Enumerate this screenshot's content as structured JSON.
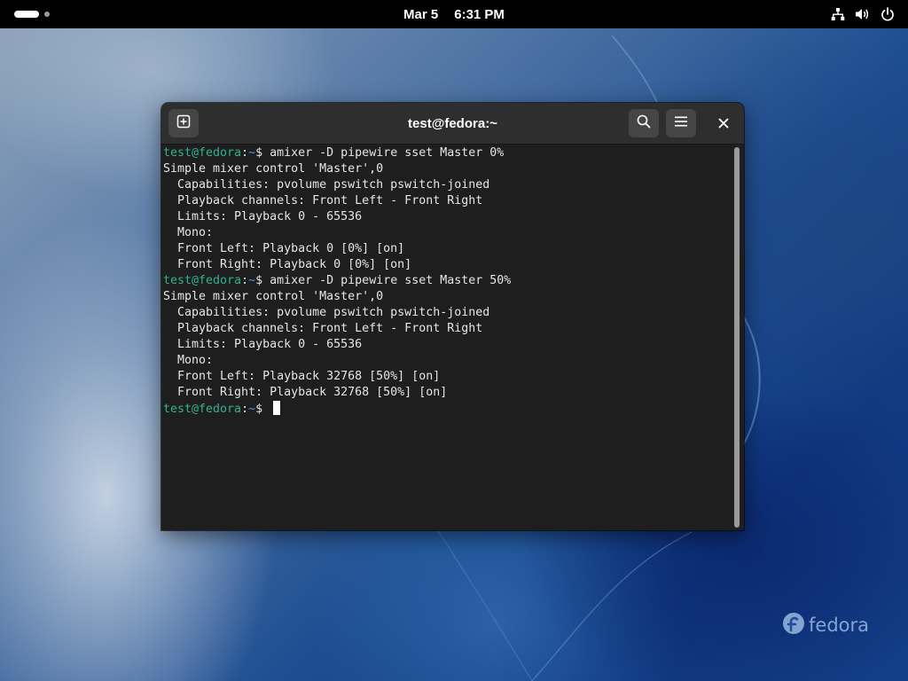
{
  "topbar": {
    "date": "Mar 5",
    "time": "6:31 PM",
    "tray_icons": [
      "network-icon",
      "volume-icon",
      "power-icon"
    ]
  },
  "window": {
    "title": "test@fedora:~",
    "buttons": [
      "new-tab-icon",
      "search-icon",
      "hamburger-menu-icon",
      "close-icon"
    ]
  },
  "terminal": {
    "prompt_user": "test@fedora",
    "prompt_sep": ":",
    "prompt_dir": "~",
    "prompt_symbol": "$",
    "lines": [
      {
        "type": "prompt",
        "command": " amixer -D pipewire sset Master 0%"
      },
      {
        "type": "output",
        "text": "Simple mixer control 'Master',0"
      },
      {
        "type": "output",
        "text": "  Capabilities: pvolume pswitch pswitch-joined"
      },
      {
        "type": "output",
        "text": "  Playback channels: Front Left - Front Right"
      },
      {
        "type": "output",
        "text": "  Limits: Playback 0 - 65536"
      },
      {
        "type": "output",
        "text": "  Mono:"
      },
      {
        "type": "output",
        "text": "  Front Left: Playback 0 [0%] [on]"
      },
      {
        "type": "output",
        "text": "  Front Right: Playback 0 [0%] [on]"
      },
      {
        "type": "prompt",
        "command": " amixer -D pipewire sset Master 50%"
      },
      {
        "type": "output",
        "text": "Simple mixer control 'Master',0"
      },
      {
        "type": "output",
        "text": "  Capabilities: pvolume pswitch pswitch-joined"
      },
      {
        "type": "output",
        "text": "  Playback channels: Front Left - Front Right"
      },
      {
        "type": "output",
        "text": "  Limits: Playback 0 - 65536"
      },
      {
        "type": "output",
        "text": "  Mono:"
      },
      {
        "type": "output",
        "text": "  Front Left: Playback 32768 [50%] [on]"
      },
      {
        "type": "output",
        "text": "  Front Right: Playback 32768 [50%] [on]"
      },
      {
        "type": "prompt",
        "command": " ",
        "cursor": true
      }
    ]
  },
  "desktop": {
    "logo_text": "fedora"
  },
  "colors": {
    "prompt_user": "#33b08f",
    "prompt_dir": "#5a8fd6",
    "terminal_bg": "#1e1e1e",
    "headerbar_bg": "#2e2e2e"
  }
}
